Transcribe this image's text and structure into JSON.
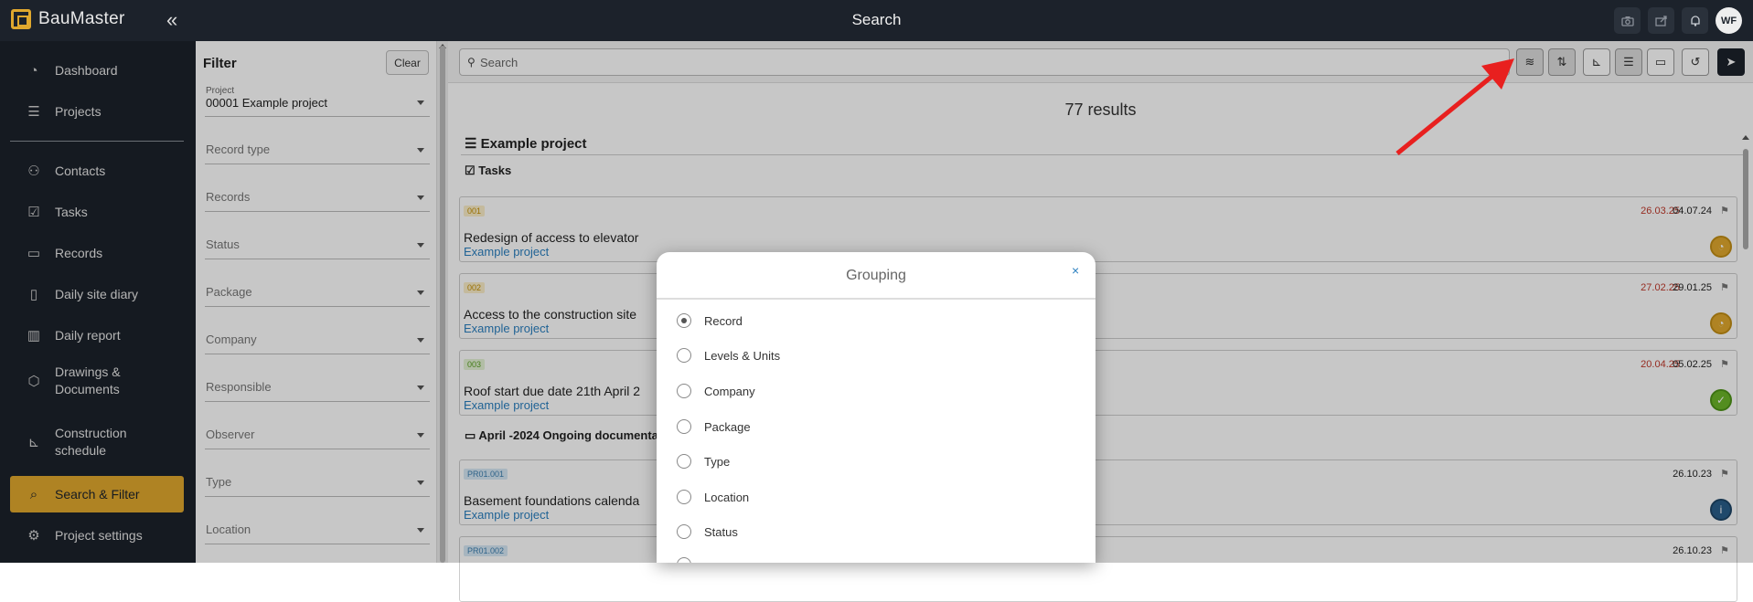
{
  "app": {
    "brand": "BauMaster",
    "page_title": "Search",
    "avatar_initials": "WF"
  },
  "sidebar": {
    "items": [
      {
        "label": "Dashboard",
        "icon": "gauge-icon"
      },
      {
        "label": "Projects",
        "icon": "list-icon"
      },
      {
        "label": "Contacts",
        "icon": "person-icon"
      },
      {
        "label": "Tasks",
        "icon": "clipboard-check-icon"
      },
      {
        "label": "Records",
        "icon": "clipboard-icon"
      },
      {
        "label": "Daily site diary",
        "icon": "book-icon"
      },
      {
        "label": "Daily report",
        "icon": "building-icon"
      },
      {
        "label": "Drawings &",
        "label2": "Documents",
        "icon": "cube-icon"
      },
      {
        "label": "Construction",
        "label2": "schedule",
        "icon": "chart-icon"
      },
      {
        "label": "Search & Filter",
        "icon": "search-doc-icon",
        "active": true
      },
      {
        "label": "Project settings",
        "icon": "sliders-icon"
      }
    ]
  },
  "filter": {
    "title": "Filter",
    "clear_label": "Clear",
    "fields": [
      {
        "small_label": "Project",
        "value": "00001 Example project"
      },
      {
        "label": "Record type"
      },
      {
        "label": "Records"
      },
      {
        "label": "Status"
      },
      {
        "label": "Package"
      },
      {
        "label": "Company"
      },
      {
        "label": "Responsible"
      },
      {
        "label": "Observer"
      },
      {
        "label": "Type"
      },
      {
        "label": "Location"
      }
    ]
  },
  "search": {
    "placeholder": "Search"
  },
  "results": {
    "count_text": "77 results",
    "group_title": "Example project",
    "subgroups": [
      {
        "title": "Tasks"
      },
      {
        "title": "April -2024 Ongoing documenta"
      }
    ],
    "cards": [
      {
        "code": "001",
        "code_color": "yellow",
        "title": "Redesign of access to elevator",
        "project": "Example project",
        "date_due": "26.03.25",
        "date": "04.07.24",
        "status": "in-progress"
      },
      {
        "code": "002",
        "code_color": "yellow",
        "title": "Access to the construction site",
        "project": "Example project",
        "date_due": "27.02.25",
        "date": "29.01.25",
        "status": "in-progress"
      },
      {
        "code": "003",
        "code_color": "green",
        "title": "Roof start due date 21th April 2",
        "project": "Example project",
        "date_due": "20.04.25",
        "date": "05.02.25",
        "status": "done"
      },
      {
        "code": "PR01.001",
        "code_color": "blue",
        "title": "Basement foundations calenda",
        "project": "Example project",
        "date_due": "",
        "date": "26.10.23",
        "status": "info"
      },
      {
        "code": "PR01.002",
        "code_color": "blue",
        "title": "",
        "project": "",
        "date_due": "",
        "date": "26.10.23",
        "status": ""
      }
    ]
  },
  "grouping_modal": {
    "title": "Grouping",
    "close": "×",
    "options": [
      {
        "label": "Record",
        "selected": true
      },
      {
        "label": "Levels & Units",
        "selected": false
      },
      {
        "label": "Company",
        "selected": false
      },
      {
        "label": "Package",
        "selected": false
      },
      {
        "label": "Type",
        "selected": false
      },
      {
        "label": "Location",
        "selected": false
      },
      {
        "label": "Status",
        "selected": false
      }
    ]
  },
  "colors": {
    "brand": "#e0a82e",
    "dark": "#1c222b",
    "link": "#2a7fbf",
    "due": "#c0392b",
    "annotation_arrow": "#e8201f"
  }
}
